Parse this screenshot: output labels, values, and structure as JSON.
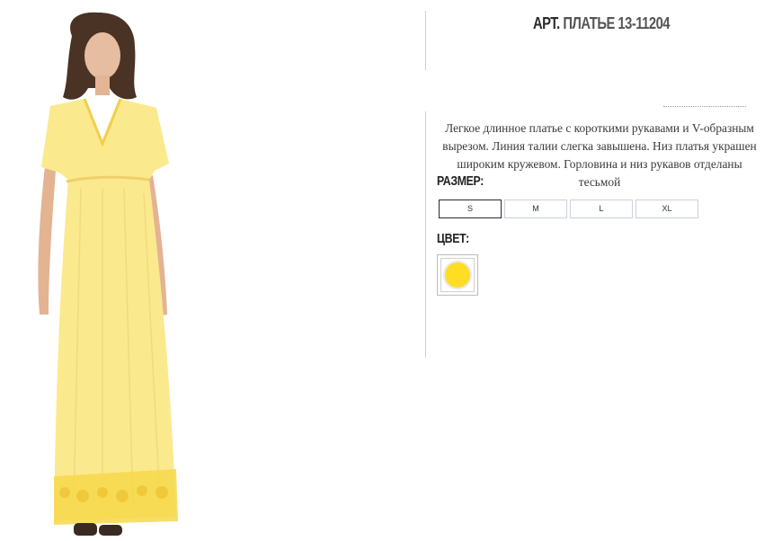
{
  "product": {
    "title_prefix": "АРТ.",
    "title_name": "ПЛАТЬЕ 13-11204",
    "description": "Легкое длинное платье с короткими рукавами и V-образным вырезом. Линия талии слегка завышена. Низ платья украшен широким кружевом. Горловина и низ рукавов отделаны тесьмой"
  },
  "size": {
    "label": "РАЗМЕР:",
    "options": [
      "S",
      "M",
      "L",
      "XL"
    ],
    "selected": "S"
  },
  "color": {
    "label": "ЦВЕТ:",
    "swatch": "#ffdd22"
  },
  "photo": {
    "dress_color": "#fbe98d",
    "lace_color": "#f6d84a"
  }
}
